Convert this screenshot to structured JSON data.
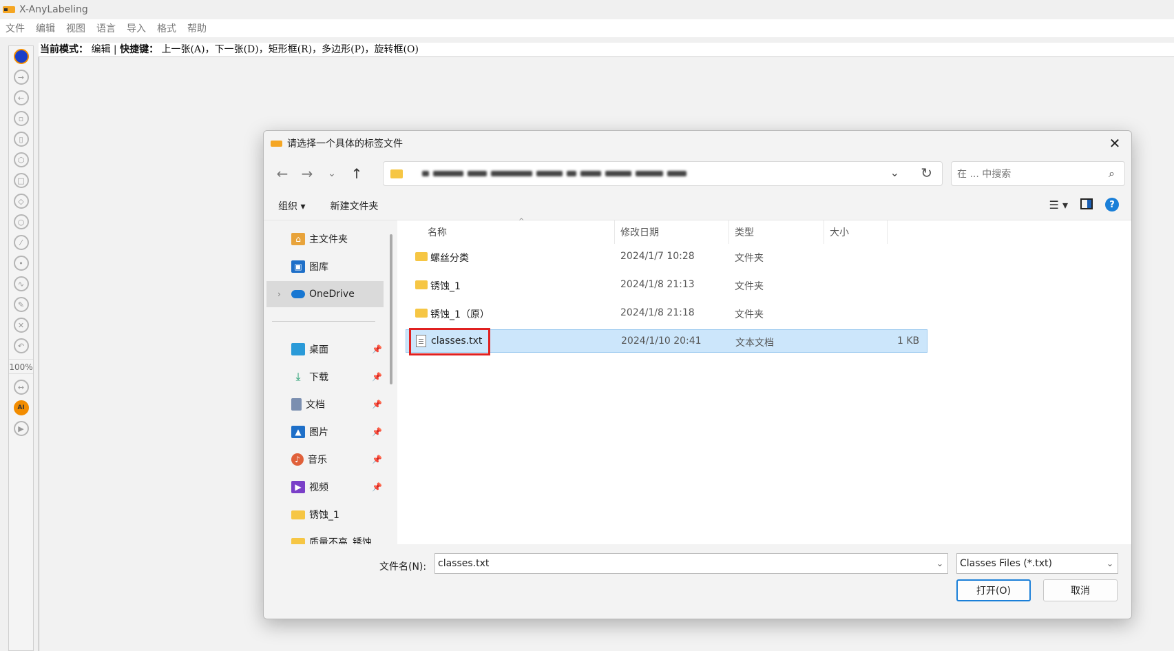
{
  "app": {
    "title": "X-AnyLabeling"
  },
  "menu": [
    "文件",
    "编辑",
    "视图",
    "语言",
    "导入",
    "格式",
    "帮助"
  ],
  "mode_bar": {
    "mode_label": "当前模式：",
    "mode_value": "编辑",
    "separator": "|",
    "shortcut_label": "快捷键：",
    "shortcuts": "上一张(A)，下一张(D)，矩形框(R)，多边形(P)，旋转框(O)"
  },
  "toolbar": {
    "zoom": "100%",
    "ai_label": "AI"
  },
  "dialog": {
    "title": "请选择一个具体的标签文件",
    "close": "✕",
    "search_placeholder": "在 ... 中搜索",
    "commands": {
      "organize": "组织 ▾",
      "new_folder": "新建文件夹"
    },
    "sidebar": [
      {
        "label": "主文件夹",
        "icon": "home-icon"
      },
      {
        "label": "图库",
        "icon": "gallery-icon"
      },
      {
        "label": "OneDrive",
        "icon": "onedrive-icon"
      },
      {
        "label": "桌面",
        "icon": "desktop-icon"
      },
      {
        "label": "下载",
        "icon": "download-icon"
      },
      {
        "label": "文档",
        "icon": "document-icon"
      },
      {
        "label": "图片",
        "icon": "pictures-icon"
      },
      {
        "label": "音乐",
        "icon": "music-icon"
      },
      {
        "label": "视频",
        "icon": "video-icon"
      },
      {
        "label": "锈蚀_1",
        "icon": "folder-icon"
      },
      {
        "label": "质量不高_锈蚀",
        "icon": "folder-icon"
      }
    ],
    "columns": {
      "name": "名称",
      "modified": "修改日期",
      "type": "类型",
      "size": "大小"
    },
    "files": [
      {
        "name": "螺丝分类",
        "modified": "2024/1/7 10:28",
        "type": "文件夹",
        "size": ""
      },
      {
        "name": "锈蚀_1",
        "modified": "2024/1/8 21:13",
        "type": "文件夹",
        "size": ""
      },
      {
        "name": "锈蚀_1（原）",
        "modified": "2024/1/8 21:18",
        "type": "文件夹",
        "size": ""
      },
      {
        "name": "classes.txt",
        "modified": "2024/1/10 20:41",
        "type": "文本文档",
        "size": "1 KB"
      }
    ],
    "footer": {
      "filename_label": "文件名(N):",
      "filename_value": "classes.txt",
      "filter": "Classes Files (*.txt)",
      "open": "打开(O)",
      "cancel": "取消"
    }
  },
  "colors": {
    "accent": "#1a7fd8",
    "selection": "#cce6fb",
    "highlight_box": "#e02020",
    "folder": "#f6c644"
  }
}
